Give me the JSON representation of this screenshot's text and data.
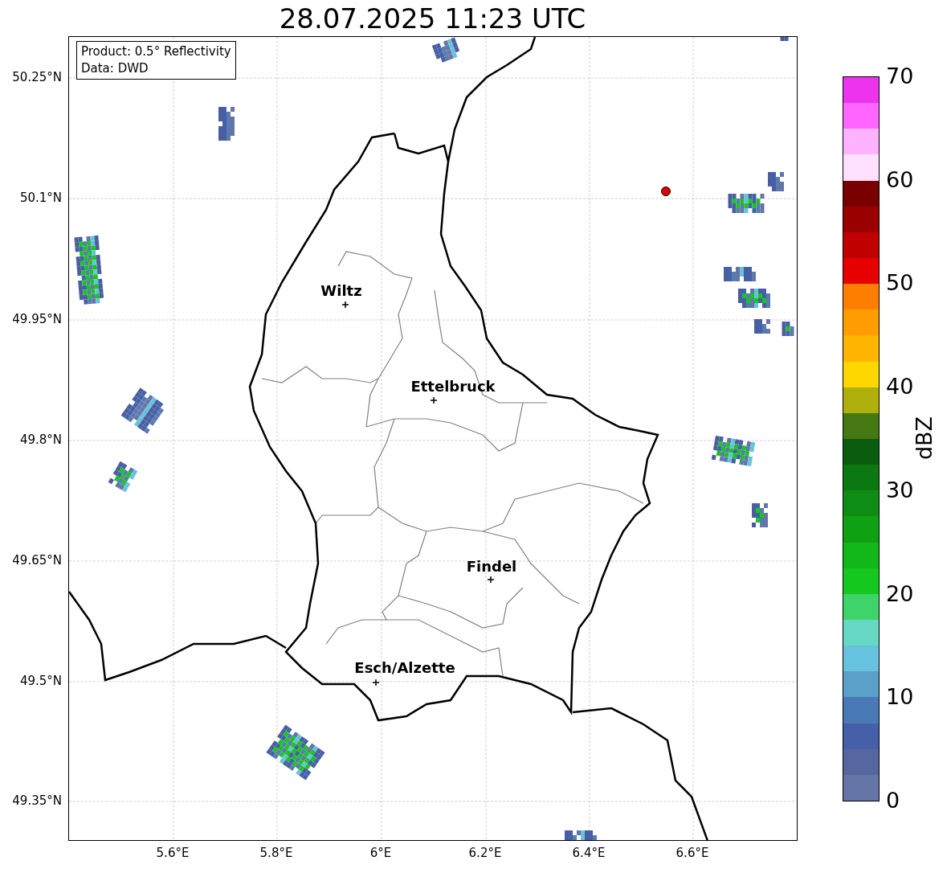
{
  "title": "28.07.2025 11:23 UTC",
  "info_box": {
    "lines": [
      "Product: 0.5° Reflectivity",
      "Data: DWD"
    ]
  },
  "map": {
    "cities": [
      {
        "name": "Wiltz"
      },
      {
        "name": "Ettelbruck"
      },
      {
        "name": "Findel"
      },
      {
        "name": "Esch/Alzette"
      }
    ],
    "x_ticks": [
      "5.6°E",
      "5.8°E",
      "6°E",
      "6.2°E",
      "6.4°E",
      "6.6°E"
    ],
    "y_ticks": [
      "50.25°N",
      "50.1°N",
      "49.95°N",
      "49.8°N",
      "49.65°N",
      "49.5°N",
      "49.35°N"
    ]
  },
  "colorbar": {
    "label": "dBZ",
    "ticks": [
      "70",
      "60",
      "50",
      "40",
      "30",
      "20",
      "10",
      "0"
    ],
    "bins": [
      {
        "color": "#6475a6"
      },
      {
        "color": "#5566a0"
      },
      {
        "color": "#4560a8"
      },
      {
        "color": "#4a7ab5"
      },
      {
        "color": "#5aa0c8"
      },
      {
        "color": "#66c2de"
      },
      {
        "color": "#66d8c4"
      },
      {
        "color": "#3ed46a"
      },
      {
        "color": "#14c81e"
      },
      {
        "color": "#12b81a"
      },
      {
        "color": "#10a014"
      },
      {
        "color": "#0f8c14"
      },
      {
        "color": "#0c7812"
      },
      {
        "color": "#0a5c0e"
      },
      {
        "color": "#457812"
      },
      {
        "color": "#b0b00c"
      },
      {
        "color": "#ffd700"
      },
      {
        "color": "#ffb400"
      },
      {
        "color": "#ff9c00"
      },
      {
        "color": "#ff7e00"
      },
      {
        "color": "#e60000"
      },
      {
        "color": "#c00000"
      },
      {
        "color": "#9a0000"
      },
      {
        "color": "#780000"
      },
      {
        "color": "#ffe0ff"
      },
      {
        "color": "#ffb3ff"
      },
      {
        "color": "#ff66ff"
      },
      {
        "color": "#ee33ee"
      }
    ]
  }
}
